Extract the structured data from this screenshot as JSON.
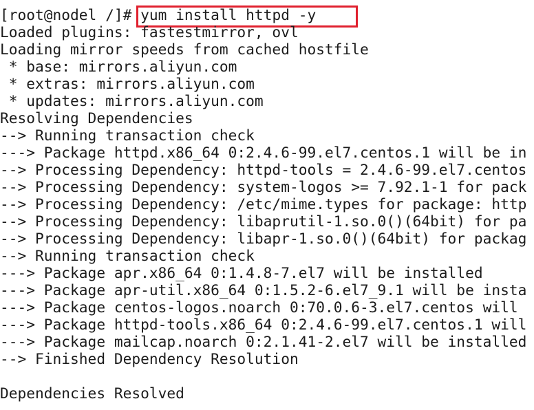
{
  "terminal": {
    "prompt": "[root@nodel /]#",
    "command": "yum install httpd -y",
    "output_lines": [
      "Loaded plugins: fastestmirror, ovl",
      "Loading mirror speeds from cached hostfile",
      " * base: mirrors.aliyun.com",
      " * extras: mirrors.aliyun.com",
      " * updates: mirrors.aliyun.com",
      "Resolving Dependencies",
      "--> Running transaction check",
      "---> Package httpd.x86_64 0:2.4.6-99.el7.centos.1 will be in",
      "--> Processing Dependency: httpd-tools = 2.4.6-99.el7.centos",
      "--> Processing Dependency: system-logos >= 7.92.1-1 for pack",
      "--> Processing Dependency: /etc/mime.types for package: http",
      "--> Processing Dependency: libaprutil-1.so.0()(64bit) for pa",
      "--> Processing Dependency: libapr-1.so.0()(64bit) for packag",
      "--> Running transaction check",
      "---> Package apr.x86_64 0:1.4.8-7.el7 will be installed",
      "---> Package apr-util.x86_64 0:1.5.2-6.el7_9.1 will be insta",
      "---> Package centos-logos.noarch 0:70.0.6-3.el7.centos will",
      "---> Package httpd-tools.x86_64 0:2.4.6-99.el7.centos.1 will",
      "---> Package mailcap.noarch 0:2.1.41-2.el7 will be installed",
      "--> Finished Dependency Resolution",
      "",
      "Dependencies Resolved"
    ]
  },
  "colors": {
    "highlight_box": "#e0202e",
    "text": "#1c1c1c",
    "background": "#ffffff"
  }
}
